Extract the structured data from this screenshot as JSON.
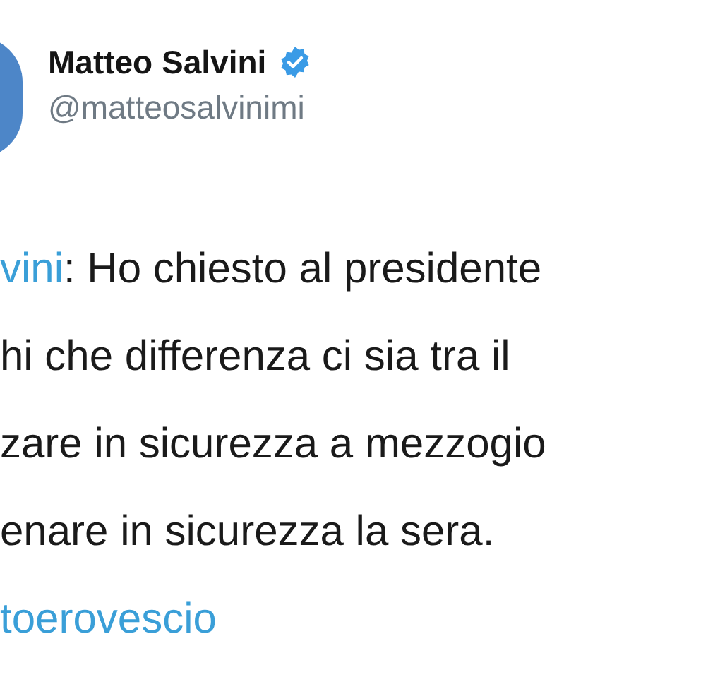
{
  "author": {
    "name": "Matteo Salvini",
    "verified": true,
    "handle": "@matteosalvinimi"
  },
  "lines": [
    {
      "parts": [
        {
          "kind": "mention",
          "text": "vini"
        },
        {
          "kind": "plain",
          "text": ": Ho chiesto al presidente"
        }
      ]
    },
    {
      "parts": [
        {
          "kind": "plain",
          "text": "hi che differenza ci sia tra il"
        }
      ]
    },
    {
      "parts": [
        {
          "kind": "plain",
          "text": "zare in sicurezza a mezzogio"
        }
      ]
    },
    {
      "parts": [
        {
          "kind": "plain",
          "text": "enare in sicurezza la sera."
        }
      ]
    },
    {
      "parts": [
        {
          "kind": "hashtag",
          "text": "toerovescio"
        }
      ]
    }
  ]
}
